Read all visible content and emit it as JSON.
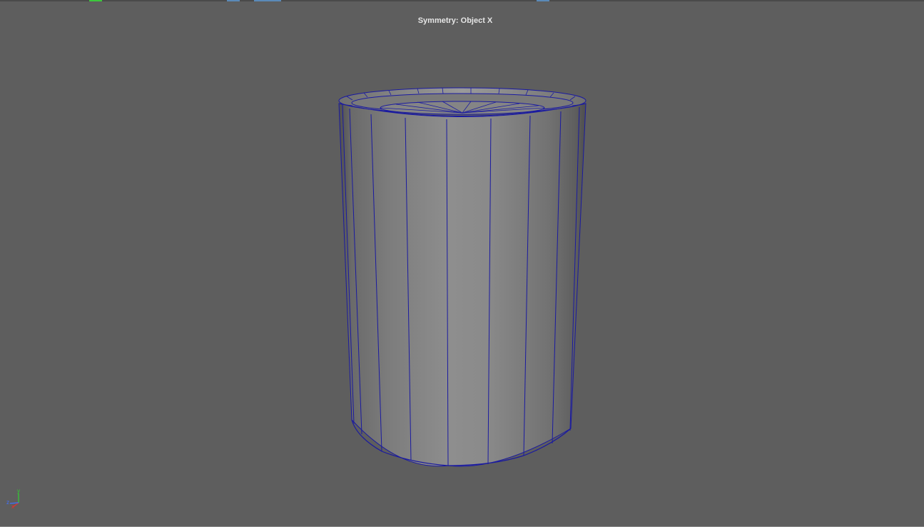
{
  "viewport": {
    "hud_title": "Symmetry: Object X",
    "background_color": "#5e5e5e",
    "wireframe_color": "#1a1aa0",
    "object_name": "cylinder-mesh",
    "axis": {
      "x_label": "x",
      "y_label": "y",
      "z_label": "z",
      "x_color": "#e03030",
      "y_color": "#30d030",
      "z_color": "#4070ff"
    }
  }
}
